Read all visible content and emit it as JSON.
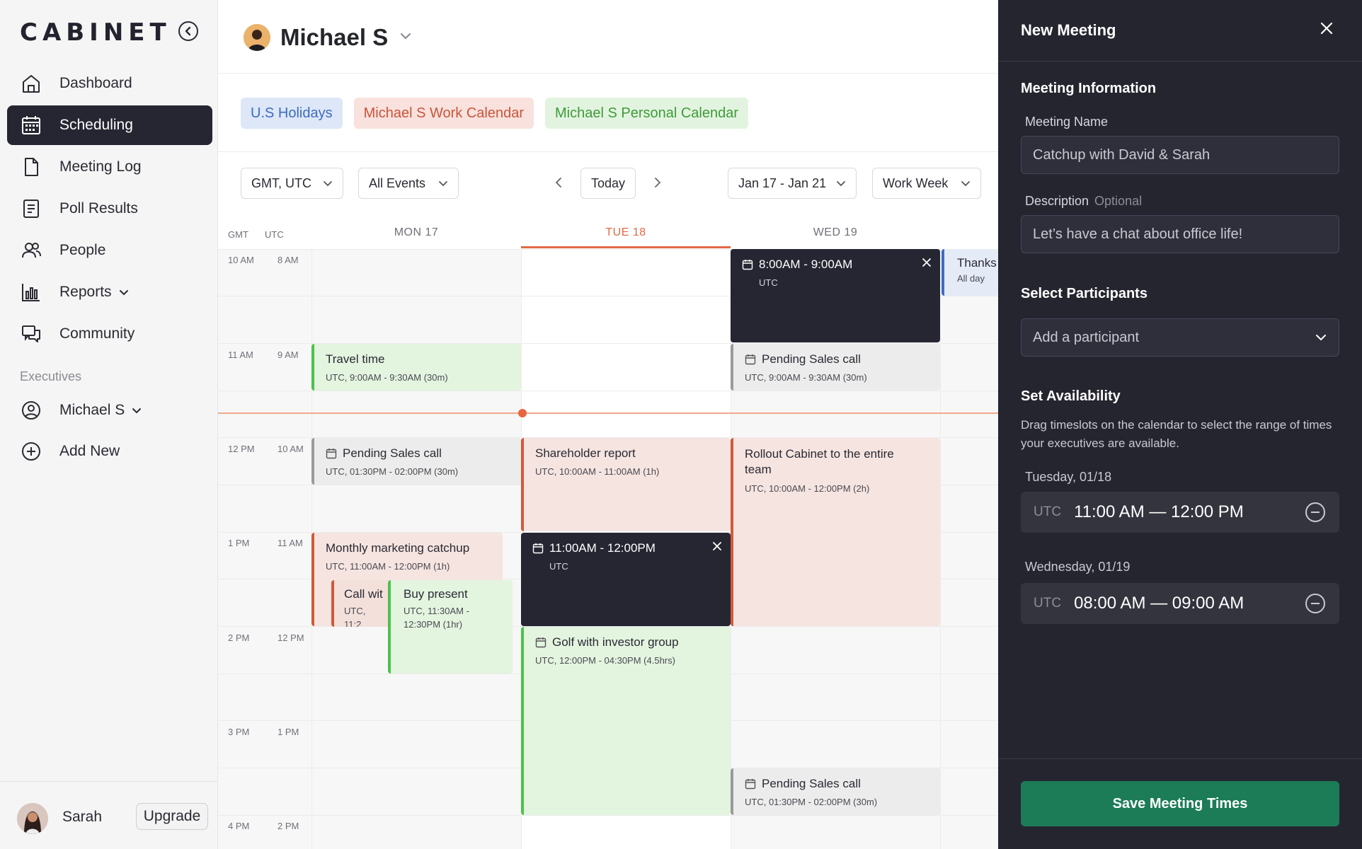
{
  "sidebar": {
    "logo": "CABINET",
    "items": [
      {
        "label": "Dashboard",
        "icon": "home-icon"
      },
      {
        "label": "Scheduling",
        "icon": "calendar-icon"
      },
      {
        "label": "Meeting Log",
        "icon": "document-icon"
      },
      {
        "label": "Poll Results",
        "icon": "list-icon"
      },
      {
        "label": "People",
        "icon": "people-icon"
      },
      {
        "label": "Reports",
        "icon": "bar-chart-icon"
      },
      {
        "label": "Community",
        "icon": "chat-icon"
      }
    ],
    "active_item": "Scheduling",
    "section_label": "Executives",
    "executive": "Michael S",
    "add_new": "Add New",
    "user_name": "Sarah",
    "upgrade": "Upgrade"
  },
  "header": {
    "executive_name": "Michael S",
    "calendars": [
      "U.S Holidays",
      "Michael S Work Calendar",
      "Michael S Personal Calendar"
    ]
  },
  "filters": {
    "timezone": "GMT, UTC",
    "events": "All Events",
    "today": "Today",
    "date_range": "Jan 17 - Jan 21",
    "view": "Work Week"
  },
  "calendar": {
    "tz_headers": [
      "GMT",
      "UTC"
    ],
    "days": [
      "MON 17",
      "TUE 18",
      "WED 19"
    ],
    "today": "TUE 18",
    "time_rows": [
      {
        "gmt": "10 AM",
        "utc": "8 AM"
      },
      {
        "gmt": "11 AM",
        "utc": "9 AM"
      },
      {
        "gmt": "12 PM",
        "utc": "10 AM"
      },
      {
        "gmt": "1 PM",
        "utc": "11 AM"
      },
      {
        "gmt": "2 PM",
        "utc": "12 PM"
      },
      {
        "gmt": "3 PM",
        "utc": "1 PM"
      },
      {
        "gmt": "4 PM",
        "utc": "2 PM"
      }
    ],
    "events": {
      "travel": {
        "title": "Travel time",
        "sub": "UTC, 9:00AM - 9:30AM (30m)"
      },
      "pending_mon": {
        "title": "Pending Sales call",
        "sub": "UTC, 01:30PM - 02:00PM (30m)"
      },
      "marketing": {
        "title": "Monthly marketing catchup",
        "sub": "UTC, 11:00AM - 12:00PM (1h)"
      },
      "call": {
        "title": "Call wit",
        "sub": "UTC, 11:2"
      },
      "present": {
        "title": "Buy present",
        "sub": "UTC, 11:30AM - 12:30PM (1hr)"
      },
      "shareholder": {
        "title": "Shareholder report",
        "sub": "UTC, 10:00AM - 11:00AM (1h)"
      },
      "slot_tue": {
        "title": "11:00AM - 12:00PM",
        "sub": "UTC"
      },
      "golf": {
        "title": "Golf with investor group",
        "sub": "UTC, 12:00PM - 04:30PM (4.5hrs)"
      },
      "slot_wed": {
        "title": "8:00AM - 9:00AM",
        "sub": "UTC"
      },
      "pending_wed1": {
        "title": "Pending Sales call",
        "sub": "UTC, 9:00AM - 9:30AM (30m)"
      },
      "rollout": {
        "title": "Rollout Cabinet to the entire team",
        "sub": "UTC, 10:00AM - 12:00PM (2h)"
      },
      "pending_wed2": {
        "title": "Pending Sales call",
        "sub": "UTC, 01:30PM - 02:00PM (30m)"
      },
      "thanks": {
        "title": "Thanks",
        "sub": "All day"
      }
    }
  },
  "panel": {
    "title": "New Meeting",
    "info_section": "Meeting Information",
    "name_label": "Meeting Name",
    "name_value": "Catchup with David & Sarah",
    "desc_label": "Description",
    "desc_optional": "Optional",
    "desc_value": "Let’s have a chat about office life!",
    "participants_section": "Select Participants",
    "participant_placeholder": "Add a participant",
    "availability_section": "Set Availability",
    "availability_help": "Drag timeslots on the calendar to select the range of times your executives are available.",
    "slots": [
      {
        "date": "Tuesday, 01/18",
        "tz": "UTC",
        "range": "11:00 AM — 12:00 PM"
      },
      {
        "date": "Wednesday, 01/19",
        "tz": "UTC",
        "range": "08:00 AM — 09:00 AM"
      }
    ],
    "save": "Save Meeting Times"
  },
  "colors": {
    "accent_dark": "#262633",
    "today_accent": "#e06a46",
    "save_green": "#1c7c58",
    "event_green": "#4cc24a",
    "event_pink": "#d2583b"
  }
}
